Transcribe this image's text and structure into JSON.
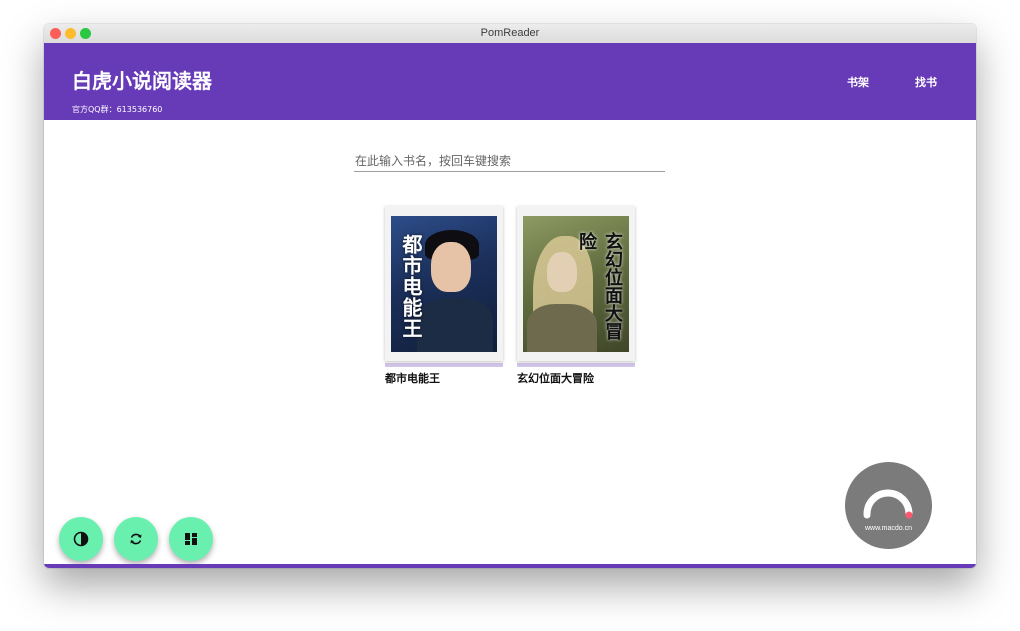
{
  "window": {
    "title": "PomReader"
  },
  "header": {
    "app_title": "白虎小说阅读器",
    "subtitle": "官方QQ群：613536760",
    "nav": [
      {
        "label": "书架"
      },
      {
        "label": "找书"
      }
    ]
  },
  "search": {
    "placeholder": "在此输入书名，按回车键搜索",
    "value": ""
  },
  "books": [
    {
      "title": "都市电能王",
      "cover_text": "都市电能王"
    },
    {
      "title": "玄幻位面大冒险",
      "cover_text": "玄幻位面大冒险"
    }
  ],
  "actions": [
    {
      "icon": "contrast-icon"
    },
    {
      "icon": "refresh-icon"
    },
    {
      "icon": "dashboard-icon"
    }
  ],
  "watermark": {
    "text": "www.macdo.cn"
  },
  "colors": {
    "primary": "#673ab7",
    "fab": "#69f0ae",
    "progress": "#d1c4e9"
  }
}
